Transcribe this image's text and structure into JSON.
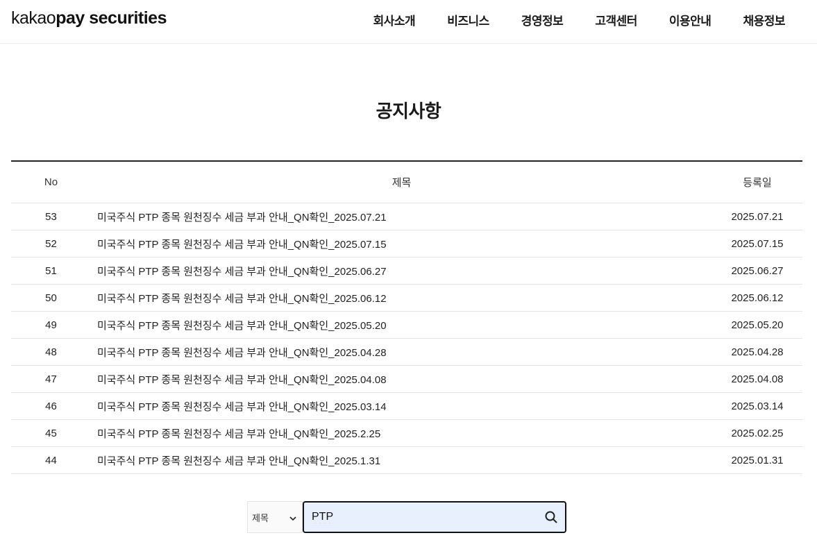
{
  "header": {
    "logo_prefix": "kakao",
    "logo_rest": "pay securities",
    "nav": [
      {
        "label": "회사소개"
      },
      {
        "label": "비즈니스"
      },
      {
        "label": "경영정보"
      },
      {
        "label": "고객센터"
      },
      {
        "label": "이용안내"
      },
      {
        "label": "채용정보"
      }
    ]
  },
  "page": {
    "title": "공지사항"
  },
  "table": {
    "headers": {
      "no": "No",
      "title": "제목",
      "date": "등록일"
    },
    "rows": [
      {
        "no": "53",
        "title": "미국주식 PTP 종목 원천징수 세금 부과 안내_QN확인_2025.07.21",
        "date": "2025.07.21"
      },
      {
        "no": "52",
        "title": "미국주식 PTP 종목 원천징수 세금 부과 안내_QN확인_2025.07.15",
        "date": "2025.07.15"
      },
      {
        "no": "51",
        "title": "미국주식 PTP 종목 원천징수 세금 부과 안내_QN확인_2025.06.27",
        "date": "2025.06.27"
      },
      {
        "no": "50",
        "title": "미국주식 PTP 종목 원천징수 세금 부과 안내_QN확인_2025.06.12",
        "date": "2025.06.12"
      },
      {
        "no": "49",
        "title": "미국주식 PTP 종목 원천징수 세금 부과 안내_QN확인_2025.05.20",
        "date": "2025.05.20"
      },
      {
        "no": "48",
        "title": "미국주식 PTP 종목 원천징수 세금 부과 안내_QN확인_2025.04.28",
        "date": "2025.04.28"
      },
      {
        "no": "47",
        "title": "미국주식 PTP 종목 원천징수 세금 부과 안내_QN확인_2025.04.08",
        "date": "2025.04.08"
      },
      {
        "no": "46",
        "title": "미국주식 PTP 종목 원천징수 세금 부과 안내_QN확인_2025.03.14",
        "date": "2025.03.14"
      },
      {
        "no": "45",
        "title": "미국주식 PTP 종목 원천징수 세금 부과 안내_QN확인_2025.2.25",
        "date": "2025.02.25"
      },
      {
        "no": "44",
        "title": "미국주식 PTP 종목 원천징수 세금 부과 안내_QN확인_2025.1.31",
        "date": "2025.01.31"
      }
    ]
  },
  "search": {
    "select_value": "제목",
    "input_value": "PTP",
    "icon": "search-icon",
    "select_icon": "chevron-down-icon"
  }
}
